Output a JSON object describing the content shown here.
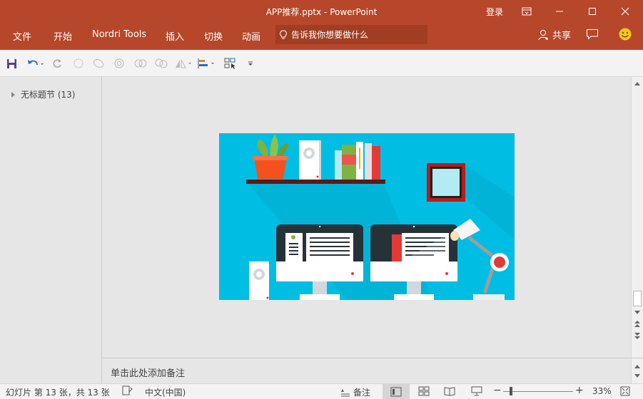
{
  "window": {
    "title": "APP推荐.pptx - PowerPoint",
    "login": "登录"
  },
  "ribbon": {
    "tabs": [
      "文件",
      "开始",
      "Nordri Tools",
      "插入",
      "切换",
      "动画"
    ],
    "tell_me": "告诉我你想要做什么",
    "share": "共享"
  },
  "thumbnails": {
    "section_label": "无标题节 (13)"
  },
  "notes": {
    "placeholder": "单击此处添加备注"
  },
  "status": {
    "slide_info": "幻灯片 第 13 张，共 13 张",
    "language": "中文(中国)",
    "notes_button": "备注",
    "zoom": "33%"
  },
  "colors": {
    "accent": "#b7472a",
    "slide_bg": "#00bde3"
  },
  "icons": [
    "save-icon",
    "undo-icon",
    "redo-icon",
    "comment-icon",
    "smiley-icon",
    "lightbulb-icon",
    "person-icon"
  ]
}
